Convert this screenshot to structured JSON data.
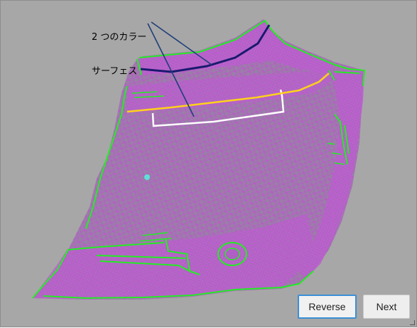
{
  "annotation": {
    "line1": "2 つのカラー",
    "line2": "サーフェス"
  },
  "buttons": {
    "reverse_label": "Reverse",
    "next_label": "Next"
  },
  "colors": {
    "viewport_background": "#a7a7a7",
    "mesh": "#c23bd4",
    "mesh_fill": "#8e72a0",
    "boundary_edges": "#22ee22",
    "collar_surface_1": "#1a1a6e",
    "collar_surface_2": "#ffffff",
    "feature_curve": "#ffd21a",
    "leader_lines": "#1f3f7a",
    "selected_button_border": "#3b8fd6"
  }
}
